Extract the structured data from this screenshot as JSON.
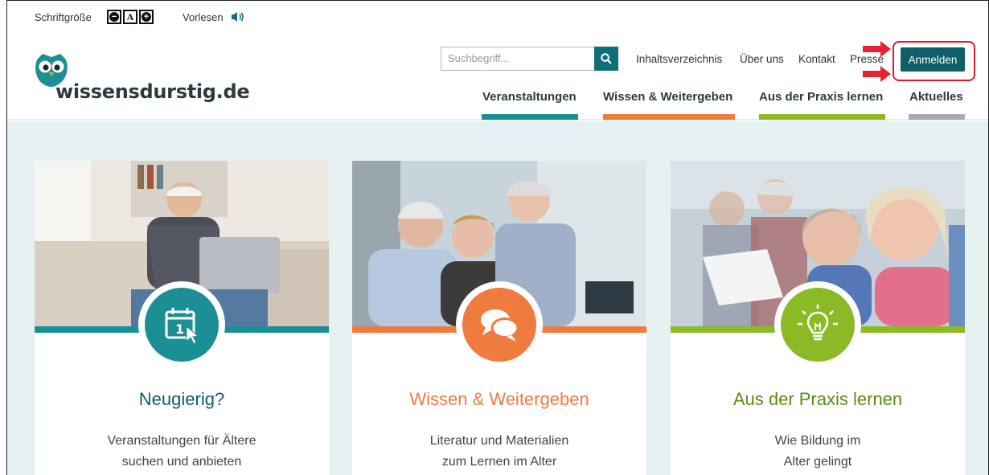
{
  "utility": {
    "font_size_label": "Schriftgröße",
    "font_minus": "−",
    "font_reset": "A",
    "font_plus": "+",
    "read_aloud_label": "Vorlesen"
  },
  "header": {
    "logo_text": "wissensdurstig.de",
    "search_placeholder": "Suchbegriff...",
    "links": {
      "index": "Inhaltsverzeichnis",
      "about": "Über uns",
      "contact": "Kontakt",
      "press": "Presse"
    },
    "login_label": "Anmelden",
    "nav": {
      "events": "Veranstaltungen",
      "knowledge": "Wissen & Weitergeben",
      "practice": "Aus der Praxis lernen",
      "news": "Aktuelles"
    }
  },
  "cards": [
    {
      "title": "Neugierig?",
      "line1": "Veranstaltungen für Ältere",
      "line2": "suchen und anbieten",
      "color": "#1c8f96",
      "title_color": "#0f5f66"
    },
    {
      "title": "Wissen & Weitergeben",
      "line1": "Literatur und Materialien",
      "line2": "zum Lernen im Alter",
      "color": "#f07b3f",
      "title_color": "#f07b3f"
    },
    {
      "title": "Aus der Praxis lernen",
      "line1": "Wie Bildung im",
      "line2": "Alter gelingt",
      "color": "#8cba27",
      "title_color": "#5f8a16"
    }
  ],
  "colors": {
    "teal": "#1c8f96",
    "orange": "#f07b3f",
    "green": "#8cba27",
    "gray": "#aaaaaa",
    "login_bg": "#0e5f68",
    "highlight_red": "#d81e2b"
  },
  "icons": {
    "speaker": "speaker-icon",
    "search": "search-icon",
    "calendar": "calendar-click-icon",
    "speech": "speech-bubbles-icon",
    "bulb": "lightbulb-icon",
    "owl": "owl-logo-icon"
  }
}
